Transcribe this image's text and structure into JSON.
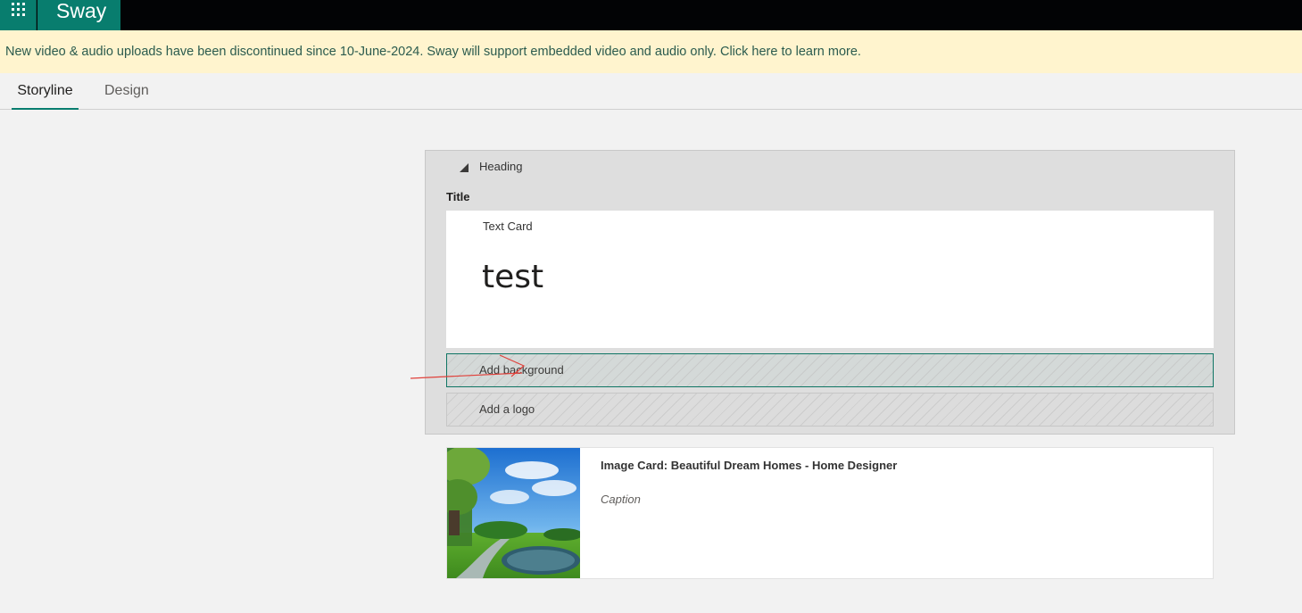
{
  "app": {
    "name": "Sway",
    "launcher_icon": "waffle-grid-icon"
  },
  "banner": {
    "text": "New video & audio uploads have been discontinued since 10-June-2024. Sway will support embedded video and audio only. Click here to learn more.",
    "background_color": "#fff4ce"
  },
  "tabs": [
    {
      "label": "Storyline",
      "active": true
    },
    {
      "label": "Design",
      "active": false
    }
  ],
  "heading_group": {
    "label": "Heading",
    "toggle_icon": "collapse-triangle-icon",
    "title_label": "Title",
    "text_card": {
      "type_label": "Text Card",
      "text": "test"
    },
    "add_background_label": "Add background",
    "add_logo_label": "Add a logo"
  },
  "image_card": {
    "title": "Image Card: Beautiful Dream Homes - Home Designer",
    "caption_placeholder": "Caption",
    "thumbnail": "landscape-thumbnail"
  },
  "colors": {
    "brand": "#087d6e",
    "topbar": "#020305",
    "annotation": "#e0403a"
  }
}
